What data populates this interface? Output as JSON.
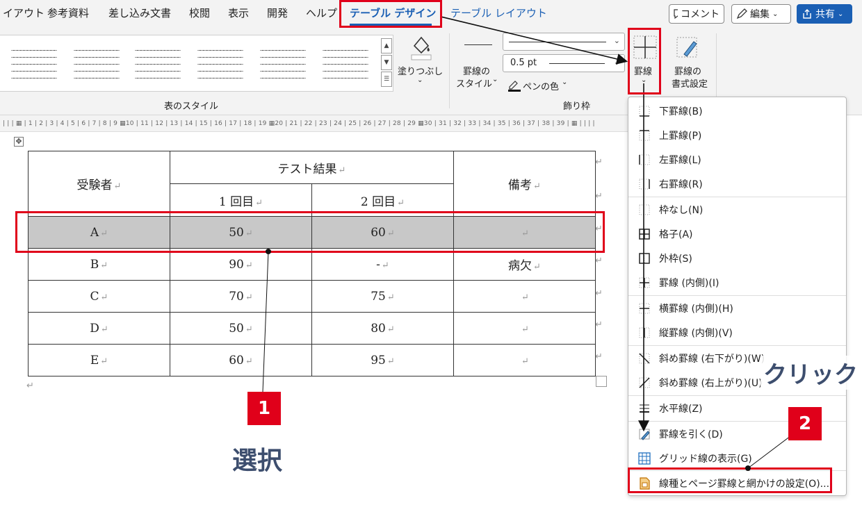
{
  "tabs": [
    "イアウト",
    "参考資料",
    "差し込み文書",
    "校閲",
    "表示",
    "開発",
    "ヘルプ",
    "テーブル デザイン",
    "テーブル レイアウト"
  ],
  "top_buttons": {
    "comment": "コメント",
    "edit": "編集",
    "share": "共有"
  },
  "ribbon": {
    "fill_label": "塗りつぶし",
    "table_styles_label": "表のスタイル",
    "border_style_label_1": "罫線の",
    "border_style_label_2": "スタイル",
    "pen_weight": "0.5 pt",
    "pen_color_label": "ペンの色",
    "borders_group_label": "飾り枠",
    "borders_button_label": "罫線",
    "border_painter_label_1": "罫線の",
    "border_painter_label_2": "書式設定"
  },
  "ruler_text": "| | | ▦  | 1 | 2 | 3 | 4 | 5 | 6 | 7 | 8 | 9 ▦10 | 11 | 12 | 13 | 14 | 15 | 16 | 17 | 18 | 19 ▦20 | 21 | 22 | 23 | 24 | 25 | 26 | 27 | 28 | 29 ▦30 | 31 | 32 | 33 | 34 | 35 | 36 | 37 | 38 | 39 | ▦ | | | |",
  "table": {
    "header_examinee": "受験者",
    "header_results": "テスト結果",
    "header_round1": "1 回目",
    "header_round2": "2 回目",
    "header_notes": "備考",
    "rows": [
      {
        "name": "A",
        "r1": "50",
        "r2": "60",
        "note": ""
      },
      {
        "name": "B",
        "r1": "90",
        "r2": "-",
        "note": "病欠"
      },
      {
        "name": "C",
        "r1": "70",
        "r2": "75",
        "note": ""
      },
      {
        "name": "D",
        "r1": "50",
        "r2": "80",
        "note": ""
      },
      {
        "name": "E",
        "r1": "60",
        "r2": "95",
        "note": ""
      }
    ]
  },
  "paragraph_mark": "↵",
  "menu_items": [
    "下罫線(B)",
    "上罫線(P)",
    "左罫線(L)",
    "右罫線(R)",
    "枠なし(N)",
    "格子(A)",
    "外枠(S)",
    "罫線 (内側)(I)",
    "横罫線 (内側)(H)",
    "縦罫線 (内側)(V)",
    "斜め罫線 (右下がり)(W)",
    "斜め罫線 (右上がり)(U)",
    "水平線(Z)",
    "罫線を引く(D)",
    "グリッド線の表示(G)",
    "線種とページ罫線と網かけの設定(O)..."
  ],
  "annotations": {
    "badge1": "1",
    "badge2": "2",
    "select_label": "選択",
    "click_label": "クリック"
  },
  "colors": {
    "accent_red": "#e0001a",
    "tab_blue": "#1a5fb4",
    "selection_gray": "#c8c8c8",
    "annotation_text": "#3d4e6e"
  }
}
